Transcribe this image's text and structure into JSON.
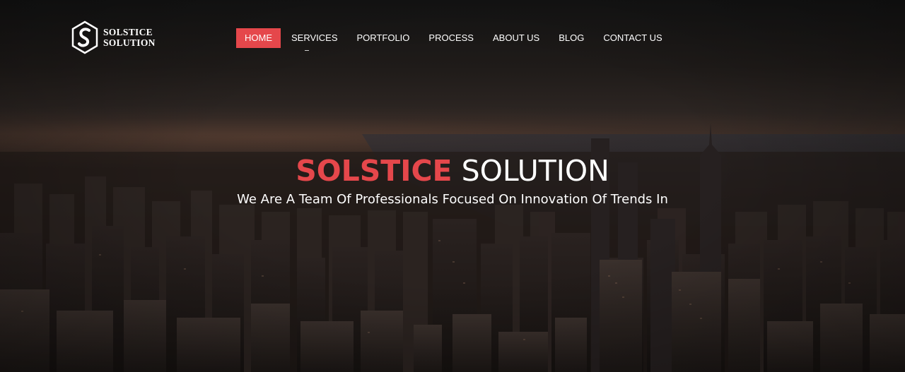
{
  "brand": {
    "line1": "SOLSTICE",
    "line2": "SOLUTION",
    "logo_icon": "hexagon-s-logo-icon"
  },
  "nav": {
    "items": [
      {
        "label": "HOME",
        "active": true
      },
      {
        "label": "SERVICES",
        "active": false,
        "has_dropdown": true
      },
      {
        "label": "PORTFOLIO",
        "active": false
      },
      {
        "label": "PROCESS",
        "active": false
      },
      {
        "label": "ABOUT US",
        "active": false
      },
      {
        "label": "BLOG",
        "active": false
      },
      {
        "label": "CONTACT US",
        "active": false
      }
    ]
  },
  "hero": {
    "title_accent": "SOLSTICE",
    "title_rest": "SOLUTION",
    "subtitle": "We Are A Team Of Professionals Focused On Innovation Of Trends In"
  },
  "colors": {
    "accent": "#e5474b",
    "text": "#ffffff",
    "overlay": "#1a1513"
  }
}
